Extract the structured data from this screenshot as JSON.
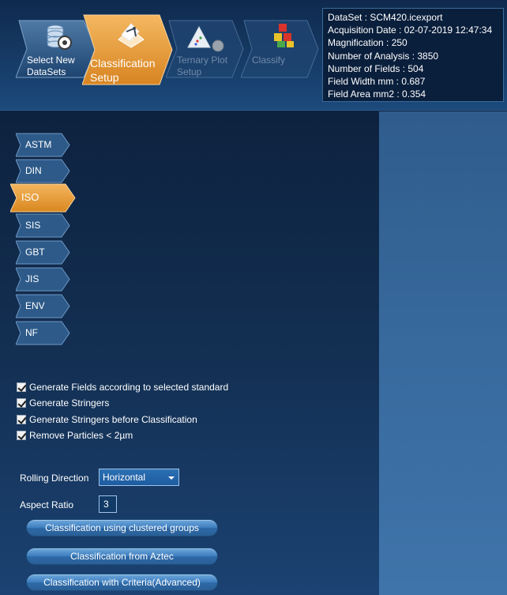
{
  "steps": [
    {
      "label": "Select New\nDataSets",
      "icon": "database-icon",
      "state": "normal"
    },
    {
      "label": "Classification\nSetup",
      "icon": "classification-icon",
      "state": "active"
    },
    {
      "label": "Ternary Plot\nSetup",
      "icon": "ternary-plot-icon",
      "state": "disabled"
    },
    {
      "label": "Classify",
      "icon": "cubes-icon",
      "state": "disabled"
    }
  ],
  "info": {
    "dataset": "DataSet :  SCM420.icexport",
    "acquisition_date": "Acquisition Date :  02-07-2019 12:47:34",
    "magnification": "Magnification :  250",
    "number_of_analysis": "Number of Analysis :  3850",
    "number_of_fields": "Number of Fields :  504",
    "field_width": "Field Width mm  :  0.687",
    "field_area": "Field Area mm2  :  0.354"
  },
  "standards": [
    {
      "label": "ASTM"
    },
    {
      "label": "DIN"
    },
    {
      "label": "ISO"
    },
    {
      "label": "SIS"
    },
    {
      "label": "GBT"
    },
    {
      "label": "JIS"
    },
    {
      "label": "ENV"
    },
    {
      "label": "NF"
    }
  ],
  "active_standard": "ISO",
  "options": [
    {
      "label": "Generate Fields according to selected standard",
      "checked": true
    },
    {
      "label": "Generate Stringers",
      "checked": true
    },
    {
      "label": "Generate Stringers before Classification",
      "checked": true
    },
    {
      "label": "Remove Particles < 2µm",
      "checked": true
    }
  ],
  "rolling_direction": {
    "label": "Rolling Direction",
    "value": "Horizontal"
  },
  "aspect_ratio": {
    "label": "Aspect Ratio",
    "value": "3"
  },
  "buttons": {
    "clustered": "Classification using clustered groups",
    "aztec": "Classification from Aztec",
    "criteria": "Classification with Criteria(Advanced)"
  },
  "colors": {
    "accent_orange": "#e8962e",
    "header_blue": "#163b66",
    "panel_blue": "#132f52"
  }
}
